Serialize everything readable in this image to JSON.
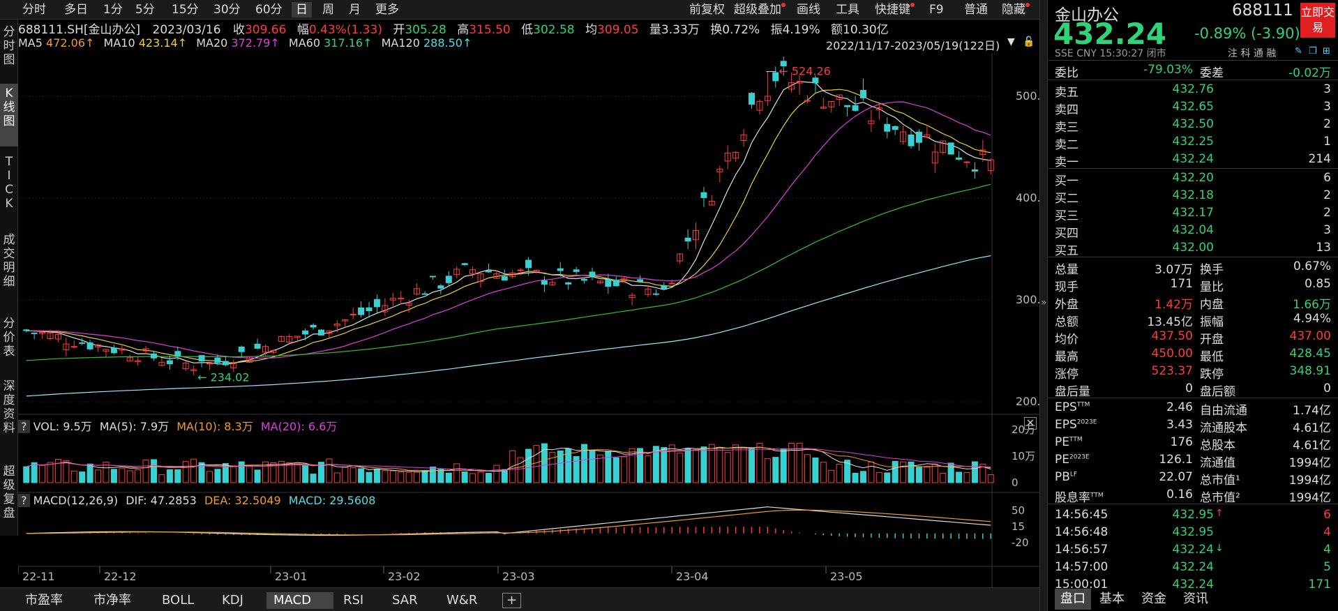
{
  "toolbar": {
    "periods": [
      "分时",
      "多日",
      "1分",
      "5分",
      "15分",
      "30分",
      "60分",
      "日",
      "周",
      "月",
      "更多"
    ],
    "selected": "日",
    "right": [
      "前复权",
      "超级叠加",
      "画线",
      "工具",
      "快捷键",
      "F9",
      "普通",
      "隐藏"
    ]
  },
  "sidebar": [
    "分时图",
    "K线图",
    "TICK",
    "成交明细",
    "分价表",
    "深度资料",
    "超级复盘"
  ],
  "sidebar_selected": "K线图",
  "info": {
    "code": "688111.SH[金山办公]",
    "date": "2023/03/16",
    "close_label": "收",
    "close": "309.66",
    "range_label": "幅",
    "range": "0.43%(1.33)",
    "open_label": "开",
    "open": "305.28",
    "high_label": "高",
    "high": "315.50",
    "low_label": "低",
    "low": "302.58",
    "avg_label": "均",
    "avg": "309.05",
    "vol_label": "量",
    "vol": "3.33万",
    "turn_label": "换",
    "turn": "0.72%",
    "amp_label": "振",
    "amp": "4.19%",
    "amt_label": "额",
    "amt": "10.30亿"
  },
  "ma": {
    "ma5_label": "MA5",
    "ma5": "472.06↑",
    "ma10_label": "MA10",
    "ma10": "423.14↑",
    "ma20_label": "MA20",
    "ma20": "372.79↑",
    "ma60_label": "MA60",
    "ma60": "317.16↑",
    "ma120_label": "MA120",
    "ma120": "288.50↑",
    "range_text": "2022/11/17-2023/05/19(122日)"
  },
  "chart_data": {
    "type": "candlestick",
    "price_ticks": [
      "500.00",
      "400.00",
      "300.00",
      "200.00"
    ],
    "high_marker": "524.26",
    "low_marker": "234.02",
    "x_labels": [
      "22-11",
      "22-12",
      "23-01",
      "23-02",
      "23-03",
      "23-04",
      "23-05"
    ],
    "volume": {
      "label": "VOL: 9.5万",
      "ma5": "MA(5): 7.9万",
      "ma10": "MA(10): 8.3万",
      "ma20": "MA(20): 6.6万",
      "ticks": [
        "20万",
        "10万",
        "0"
      ]
    },
    "macd": {
      "label": "MACD(12,26,9)",
      "dif": "DIF: 47.2853",
      "dea": "DEA: 32.5049",
      "macd": "MACD: 29.5608",
      "ticks": [
        "50",
        "15",
        "-20"
      ]
    },
    "key_points": [
      {
        "x": "2022-11-17",
        "close": 270
      },
      {
        "x": "2022-12-20",
        "close": 234.02
      },
      {
        "x": "2023-01-16",
        "close": 280
      },
      {
        "x": "2023-02-08",
        "close": 330
      },
      {
        "x": "2023-03-16",
        "close": 309.66
      },
      {
        "x": "2023-04-03",
        "close": 524.26
      },
      {
        "x": "2023-05-19",
        "close": 432.24
      }
    ],
    "colors": {
      "up": "#ff3b3b",
      "down": "#38d0d0",
      "ma5": "#e0e0e0",
      "ma10": "#e7d23a",
      "ma20": "#e13de1",
      "ma60": "#2fbf2f",
      "ma120": "#9ee8ff"
    }
  },
  "bottom_tabs": [
    "市盈率",
    "市净率",
    "BOLL",
    "KDJ",
    "MACD",
    "RSI",
    "SAR",
    "W&R"
  ],
  "bottom_selected": "MACD",
  "quote": {
    "name": "金山办公",
    "code": "688111",
    "price": "432.24",
    "change": "-0.89% (-3.90)",
    "market": "SSE  CNY  15:30:27  闭市",
    "tags": "注 科 通 融",
    "trade_button": "立即交易",
    "weibi_label": "委比",
    "weibi": "-79.03%",
    "weicha_label": "委差",
    "weicha": "-0.02万",
    "asks": [
      {
        "label": "卖五",
        "price": "432.76",
        "vol": "3"
      },
      {
        "label": "卖四",
        "price": "432.65",
        "vol": "3"
      },
      {
        "label": "卖三",
        "price": "432.50",
        "vol": "2"
      },
      {
        "label": "卖二",
        "price": "432.25",
        "vol": "1"
      },
      {
        "label": "卖一",
        "price": "432.24",
        "vol": "214"
      }
    ],
    "bids": [
      {
        "label": "买一",
        "price": "432.20",
        "vol": "6"
      },
      {
        "label": "买二",
        "price": "432.18",
        "vol": "2"
      },
      {
        "label": "买三",
        "price": "432.17",
        "vol": "2"
      },
      {
        "label": "买四",
        "price": "432.04",
        "vol": "3"
      },
      {
        "label": "买五",
        "price": "432.00",
        "vol": "13"
      }
    ],
    "stats": [
      {
        "l1": "总量",
        "v1": "3.07万",
        "c1": "w",
        "l2": "换手",
        "v2": "0.67%",
        "c2": "w"
      },
      {
        "l1": "现手",
        "v1": "171",
        "c1": "w",
        "l2": "量比",
        "v2": "0.85",
        "c2": "w"
      },
      {
        "l1": "外盘",
        "v1": "1.42万",
        "c1": "r",
        "l2": "内盘",
        "v2": "1.66万",
        "c2": "g"
      },
      {
        "l1": "总额",
        "v1": "13.45亿",
        "c1": "w",
        "l2": "振幅",
        "v2": "4.94%",
        "c2": "w"
      },
      {
        "l1": "均价",
        "v1": "437.50",
        "c1": "r",
        "l2": "开盘",
        "v2": "437.00",
        "c2": "r"
      },
      {
        "l1": "最高",
        "v1": "450.00",
        "c1": "r",
        "l2": "最低",
        "v2": "428.45",
        "c2": "g"
      },
      {
        "l1": "涨停",
        "v1": "523.37",
        "c1": "r",
        "l2": "跌停",
        "v2": "348.91",
        "c2": "g"
      },
      {
        "l1": "盘后量",
        "v1": "0",
        "c1": "w",
        "l2": "盘后额",
        "v2": "0",
        "c2": "w"
      }
    ],
    "fund": [
      {
        "l1": "EPS",
        "s1": "TTM",
        "v1": "2.46",
        "l2": "自由流通",
        "v2": "1.74亿"
      },
      {
        "l1": "EPS",
        "s1": "2023E",
        "v1": "3.43",
        "l2": "流通股本",
        "v2": "4.61亿"
      },
      {
        "l1": "PE",
        "s1": "TTM",
        "v1": "176",
        "l2": "总股本",
        "v2": "4.61亿"
      },
      {
        "l1": "PE",
        "s1": "2023E",
        "v1": "126.1",
        "l2": "流通值",
        "v2": "1994亿"
      },
      {
        "l1": "PB",
        "s1": "LF",
        "v1": "22.07",
        "l2": "总市值¹",
        "v2": "1994亿"
      },
      {
        "l1": "股息率",
        "s1": "TTM",
        "v1": "0.16",
        "l2": "总市值²",
        "v2": "1994亿"
      }
    ],
    "ticks": [
      {
        "time": "14:56:45",
        "price": "432.95",
        "arrow": "↑",
        "vol": "6",
        "vc": "r"
      },
      {
        "time": "14:56:48",
        "price": "432.95",
        "arrow": "",
        "vol": "4",
        "vc": "r"
      },
      {
        "time": "14:56:57",
        "price": "432.24",
        "arrow": "↓",
        "vol": "4",
        "vc": "g"
      },
      {
        "time": "14:57:00",
        "price": "432.24",
        "arrow": "",
        "vol": "5",
        "vc": "g"
      },
      {
        "time": "15:00:01",
        "price": "432.24",
        "arrow": "",
        "vol": "171",
        "vc": "g"
      }
    ],
    "tabs": [
      "盘口",
      "基本",
      "资金",
      "资讯"
    ],
    "tab_selected": "盘口"
  }
}
